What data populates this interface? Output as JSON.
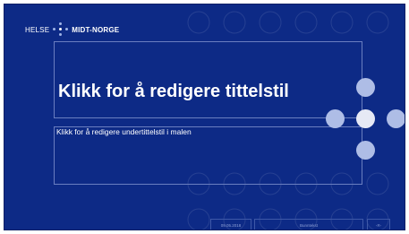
{
  "brand": {
    "helse": "HELSE",
    "midt": "MIDT-NORGE"
  },
  "title": "Klikk for å redigere tittelstil",
  "subtitle": "Klikk for å redigere undertittelstil i malen",
  "footer": {
    "date": "09.05.2018",
    "text": "Bunntekst",
    "page": "‹#›"
  },
  "colors": {
    "background": "#0d2a86",
    "circle_light": "#c8d2ee",
    "circle_mid": "#aebde6",
    "circle_white": "#e6e9f5"
  }
}
